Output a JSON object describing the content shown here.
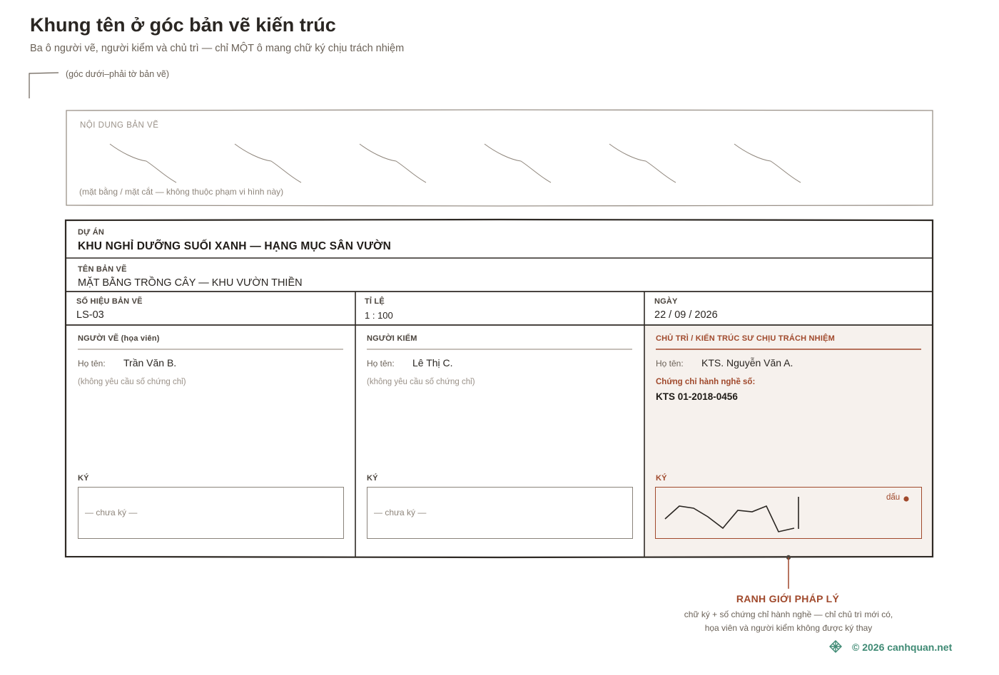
{
  "header": {
    "title": "Khung tên ở góc bản vẽ kiến trúc",
    "subtitle": "Ba ô người vẽ, người kiểm và chủ trì — chỉ MỘT ô mang chữ ký chịu trách nhiệm",
    "corner_note": "(góc dưới–phải tờ bản vẽ)"
  },
  "drawing_area": {
    "label": "NỘI DUNG BẢN VẼ",
    "note": "(mặt bằng / mặt cắt — không thuộc phạm vi hình này)"
  },
  "title_block": {
    "project_label": "DỰ ÁN",
    "project_value": "KHU NGHỈ DƯỠNG SUỐI XANH — HẠNG MỤC SÂN VƯỜN",
    "sheet_name_label": "TÊN BẢN VẼ",
    "sheet_name_value": "MẶT BẰNG TRỒNG CÂY — KHU VƯỜN THIỀN",
    "sheet_no_label": "SỐ HIỆU BẢN VẼ",
    "sheet_no_value": "LS-03",
    "scale_label": "TỈ LỆ",
    "scale_value": "1 : 100",
    "date_label": "NGÀY",
    "date_value": "22 / 09 / 2026",
    "drafter": {
      "heading": "NGƯỜI VẼ (họa viên)",
      "name_label": "Họ tên:",
      "name_value": "Trần Văn B.",
      "cert_note": "(không yêu cầu số chứng chỉ)",
      "sign_label": "KÝ",
      "sign_placeholder": "— chưa ký —"
    },
    "checker": {
      "heading": "NGƯỜI KIỂM",
      "name_label": "Họ tên:",
      "name_value": "Lê Thị C.",
      "cert_note": "(không yêu cầu số chứng chỉ)",
      "sign_label": "KÝ",
      "sign_placeholder": "— chưa ký —"
    },
    "responsible": {
      "heading": "CHỦ TRÌ / KIẾN TRÚC SƯ CHỊU TRÁCH NHIỆM",
      "name_label": "Họ tên:",
      "name_value": "KTS. Nguyễn Văn A.",
      "cert_label": "Chứng chỉ hành nghề số:",
      "cert_value": "KTS 01-2018-0456",
      "sign_label": "KÝ",
      "stamp_label": "dấu"
    }
  },
  "callout": {
    "title": "RANH GIỚI PHÁP LÝ",
    "line1": "chữ ký + số chứng chỉ hành nghề — chỉ chủ trì mới có,",
    "line2": "họa viên và người kiểm không được ký thay"
  },
  "footer": {
    "copyright": "© 2026 canhquan.net"
  },
  "colors": {
    "ink": "#2a2622",
    "accent_rust": "#a0492c",
    "responsible_fill": "#f6f1ed",
    "brand_green": "#3f8a74"
  }
}
